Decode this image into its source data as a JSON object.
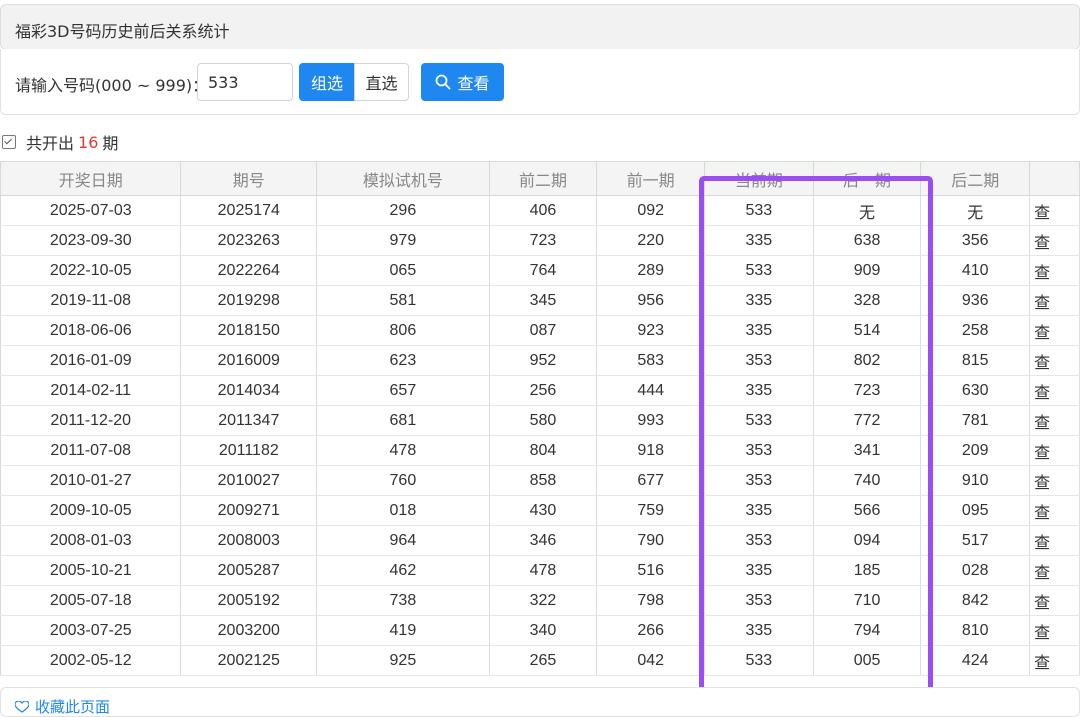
{
  "panel": {
    "title": "福彩3D号码历史前后关系统计"
  },
  "query": {
    "label": "请输入号码(000 ~ 999)：",
    "input_value": "533",
    "group_label": "组选",
    "direct_label": "直选",
    "view_label": "查看"
  },
  "summary": {
    "prefix": "共开出",
    "count": "16",
    "suffix": "期"
  },
  "table": {
    "headers": [
      "开奖日期",
      "期号",
      "模拟试机号",
      "前二期",
      "前一期",
      "当前期",
      "后一期",
      "后二期",
      ""
    ],
    "rows": [
      [
        "2025-07-03",
        "2025174",
        "296",
        "406",
        "092",
        "533",
        "无",
        "无",
        "查"
      ],
      [
        "2023-09-30",
        "2023263",
        "979",
        "723",
        "220",
        "335",
        "638",
        "356",
        "查"
      ],
      [
        "2022-10-05",
        "2022264",
        "065",
        "764",
        "289",
        "533",
        "909",
        "410",
        "查"
      ],
      [
        "2019-11-08",
        "2019298",
        "581",
        "345",
        "956",
        "335",
        "328",
        "936",
        "查"
      ],
      [
        "2018-06-06",
        "2018150",
        "806",
        "087",
        "923",
        "335",
        "514",
        "258",
        "查"
      ],
      [
        "2016-01-09",
        "2016009",
        "623",
        "952",
        "583",
        "353",
        "802",
        "815",
        "查"
      ],
      [
        "2014-02-11",
        "2014034",
        "657",
        "256",
        "444",
        "335",
        "723",
        "630",
        "查"
      ],
      [
        "2011-12-20",
        "2011347",
        "681",
        "580",
        "993",
        "533",
        "772",
        "781",
        "查"
      ],
      [
        "2011-07-08",
        "2011182",
        "478",
        "804",
        "918",
        "353",
        "341",
        "209",
        "查"
      ],
      [
        "2010-01-27",
        "2010027",
        "760",
        "858",
        "677",
        "353",
        "740",
        "910",
        "查"
      ],
      [
        "2009-10-05",
        "2009271",
        "018",
        "430",
        "759",
        "335",
        "566",
        "095",
        "查"
      ],
      [
        "2008-01-03",
        "2008003",
        "964",
        "346",
        "790",
        "353",
        "094",
        "517",
        "查"
      ],
      [
        "2005-10-21",
        "2005287",
        "462",
        "478",
        "516",
        "335",
        "185",
        "028",
        "查"
      ],
      [
        "2005-07-18",
        "2005192",
        "738",
        "322",
        "798",
        "353",
        "710",
        "842",
        "查"
      ],
      [
        "2003-07-25",
        "2003200",
        "419",
        "340",
        "266",
        "335",
        "794",
        "810",
        "查"
      ],
      [
        "2002-05-12",
        "2002125",
        "925",
        "265",
        "042",
        "533",
        "005",
        "424",
        "查"
      ]
    ]
  },
  "footer": {
    "link_label": "收藏此页面"
  },
  "colors": {
    "accent": "#1e88f0",
    "highlight": "#9b4df5",
    "count": "#e03a2c"
  }
}
